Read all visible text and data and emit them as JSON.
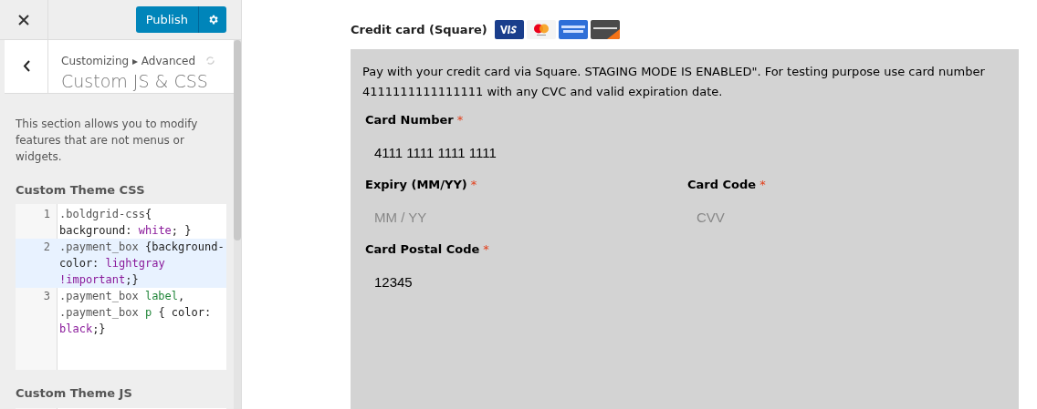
{
  "sidebar": {
    "publish_button": "Publish",
    "breadcrumb": "Customizing ▸ Advanced",
    "title": "Custom JS & CSS",
    "description": "This section allows you to modify features that are not menus or widgets.",
    "css_section": {
      "label": "Custom Theme CSS",
      "lines": [
        {
          "number": "1",
          "active": false,
          "tokens": [
            {
              "kind": "selector",
              "text": ".boldgrid-css"
            },
            {
              "kind": "plain",
              "text": "{ background: "
            },
            {
              "kind": "value",
              "text": "white"
            },
            {
              "kind": "plain",
              "text": "; }"
            }
          ]
        },
        {
          "number": "2",
          "active": true,
          "tokens": [
            {
              "kind": "selector",
              "text": ".payment_box"
            },
            {
              "kind": "plain",
              "text": " {background-color: "
            },
            {
              "kind": "value",
              "text": "lightgray !important"
            },
            {
              "kind": "plain",
              "text": ";}"
            }
          ]
        },
        {
          "number": "3",
          "active": false,
          "tokens": [
            {
              "kind": "selector",
              "text": ".payment_box "
            },
            {
              "kind": "tag",
              "text": "label"
            },
            {
              "kind": "plain",
              "text": ", "
            },
            {
              "kind": "selector",
              "text": ".payment_box "
            },
            {
              "kind": "tag",
              "text": "p"
            },
            {
              "kind": "plain",
              "text": " { color: "
            },
            {
              "kind": "value",
              "text": "black"
            },
            {
              "kind": "plain",
              "text": ";}"
            }
          ]
        }
      ]
    },
    "js_section": {
      "label": "Custom Theme JS"
    }
  },
  "payment": {
    "method": "Credit card (Square)",
    "description": "Pay with your credit card via Square. STAGING MODE IS ENABLED\". For testing purpose use card number 4111111111111111 with any CVC and valid expiration date.",
    "field_rows": [
      [
        {
          "label": "Card Number",
          "required_mark": "*",
          "value": "4111 1111 1111 1111"
        }
      ],
      [
        {
          "label": "Expiry (MM/YY)",
          "required_mark": "*",
          "placeholder": "MM / YY"
        },
        {
          "label": "Card Code",
          "required_mark": "*",
          "placeholder": "CVV"
        }
      ],
      [
        {
          "label": "Card Postal Code",
          "required_mark": "*",
          "value": "12345"
        }
      ]
    ]
  }
}
